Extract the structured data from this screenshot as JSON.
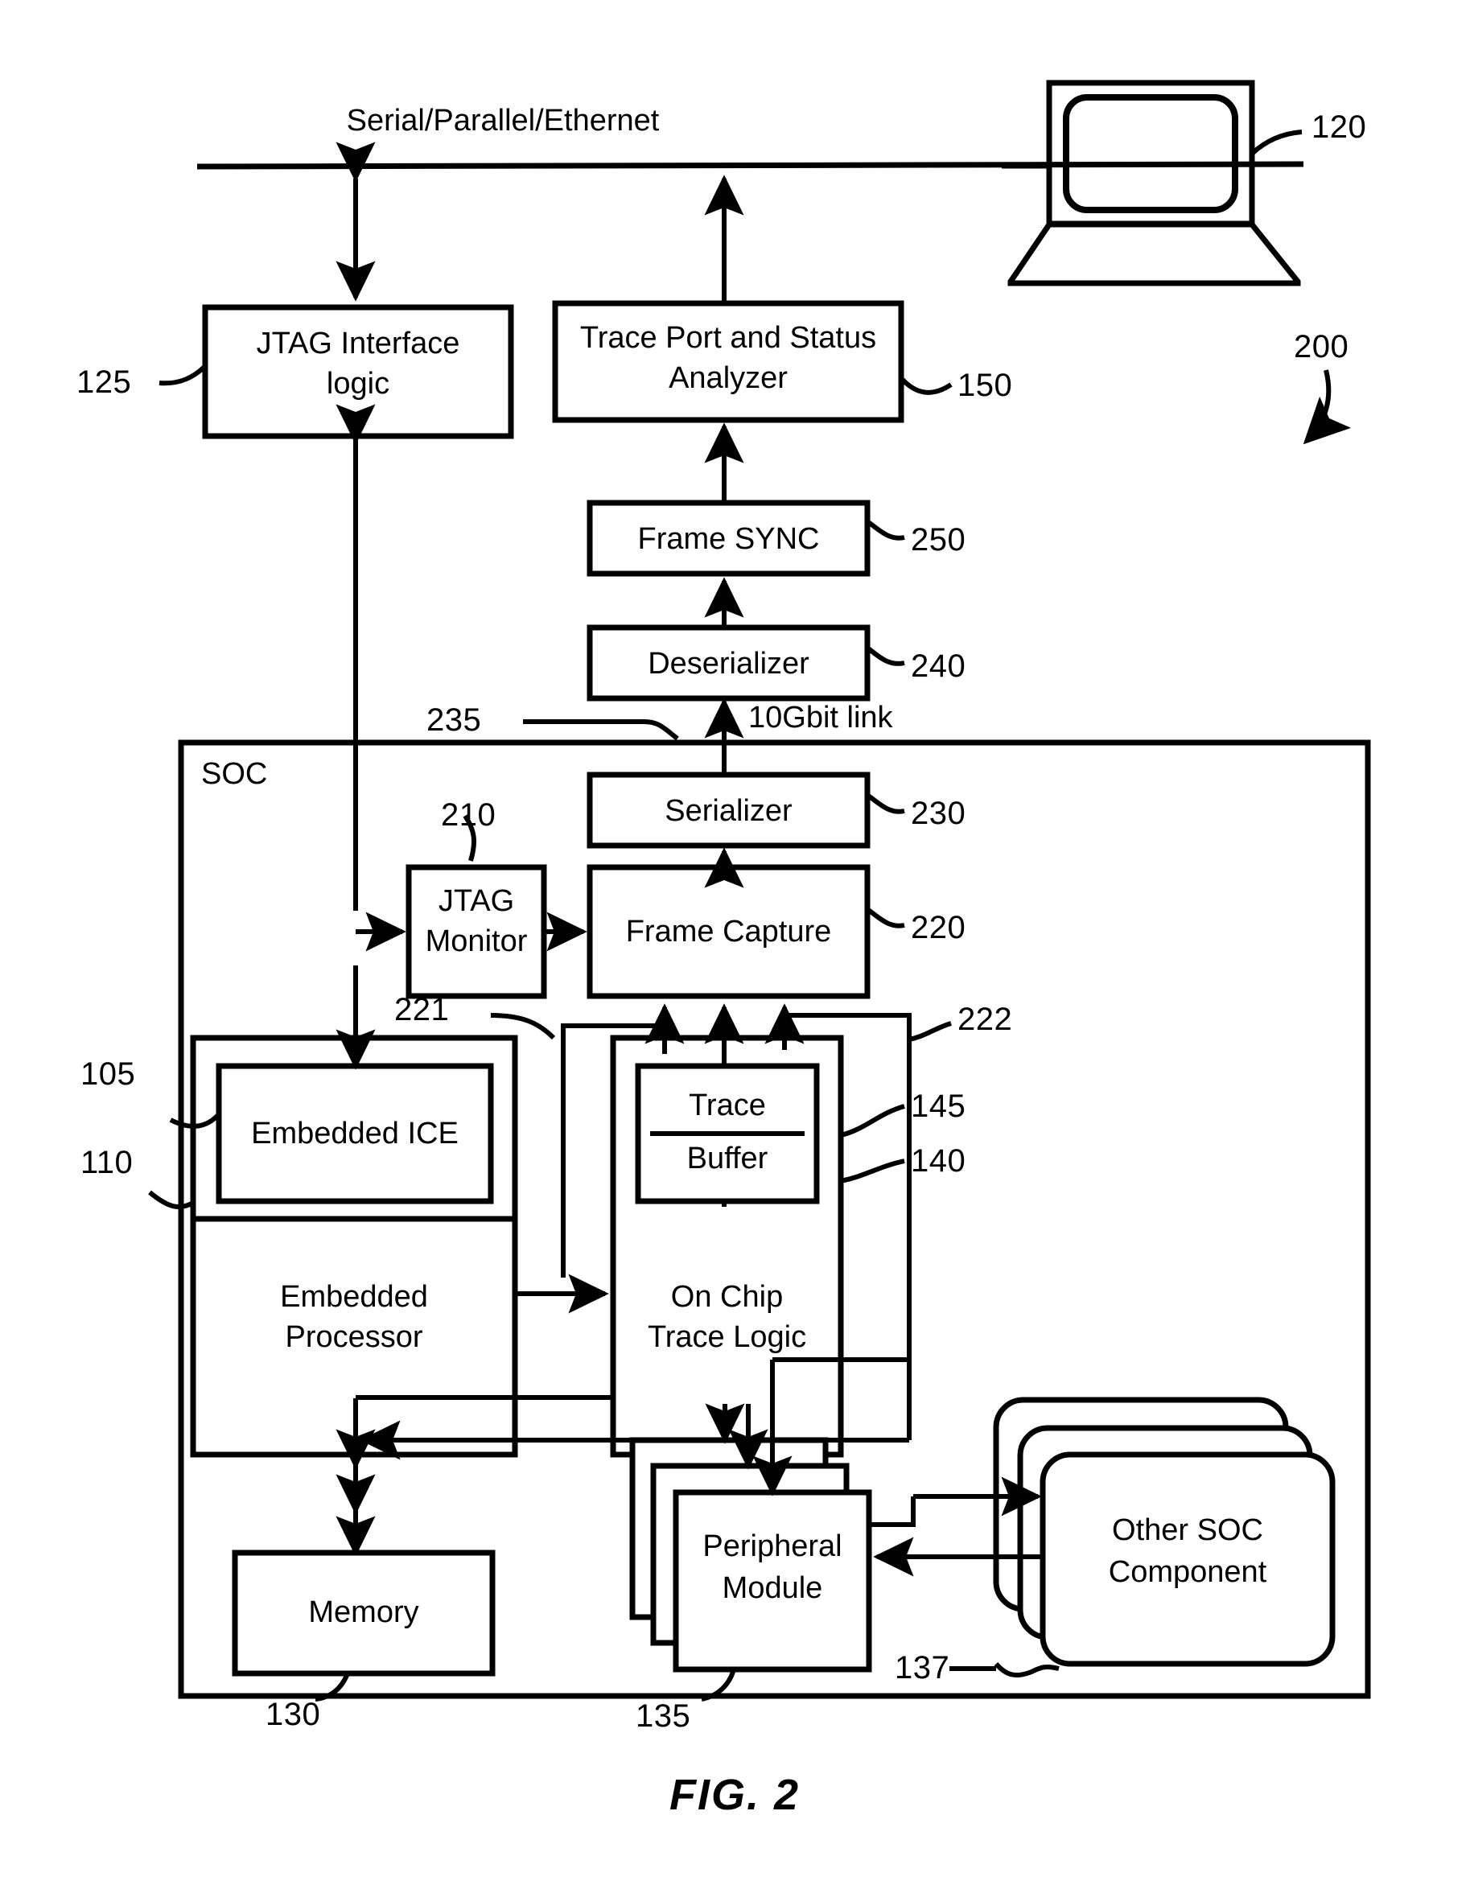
{
  "figure": {
    "caption": "FIG. 2",
    "system_ref": "200"
  },
  "bus": {
    "label": "Serial/Parallel/Ethernet"
  },
  "host": {
    "name": "laptop-computer",
    "ref": "120"
  },
  "blocks": [
    {
      "id": "jtag-interface-logic",
      "lines": [
        "JTAG Interface",
        "logic"
      ],
      "ref": "125"
    },
    {
      "id": "trace-port-status-analyzer",
      "lines": [
        "Trace Port and Status",
        "Analyzer"
      ],
      "ref": "150"
    },
    {
      "id": "frame-sync",
      "lines": [
        "Frame SYNC"
      ],
      "ref": "250"
    },
    {
      "id": "deserializer",
      "lines": [
        "Deserializer"
      ],
      "ref": "240"
    },
    {
      "id": "serializer",
      "lines": [
        "Serializer"
      ],
      "ref": "230"
    },
    {
      "id": "jtag-monitor",
      "lines": [
        "JTAG",
        "Monitor"
      ],
      "ref": "210"
    },
    {
      "id": "frame-capture",
      "lines": [
        "Frame Capture"
      ],
      "ref": "220"
    },
    {
      "id": "embedded-ice",
      "lines": [
        "Embedded ICE"
      ],
      "ref": "105"
    },
    {
      "id": "embedded-processor",
      "lines": [
        "Embedded",
        "Processor"
      ],
      "ref": "110"
    },
    {
      "id": "trace-buffer",
      "lines": [
        "Trace",
        "Buffer"
      ],
      "ref": "145"
    },
    {
      "id": "on-chip-trace-logic",
      "lines": [
        "On Chip",
        "Trace Logic"
      ],
      "ref": "140"
    },
    {
      "id": "memory",
      "lines": [
        "Memory"
      ],
      "ref": "130"
    },
    {
      "id": "peripheral-module",
      "lines": [
        "Peripheral",
        "Module"
      ],
      "ref": "135"
    },
    {
      "id": "other-soc-component",
      "lines": [
        "Other SOC",
        "Component"
      ],
      "ref": "137"
    }
  ],
  "soc": {
    "tag": "SOC"
  },
  "links": {
    "tengbit_label": "10Gbit link",
    "tengbit_ref": "235",
    "frame_capture_input_left_ref": "221",
    "frame_capture_input_right_ref": "222"
  },
  "text": {
    "bus_label": "Serial/Parallel/Ethernet",
    "jtag_interface_line1": "JTAG Interface",
    "jtag_interface_line2": "logic",
    "trace_port_line1": "Trace Port and Status",
    "trace_port_line2": "Analyzer",
    "frame_sync": "Frame SYNC",
    "deserializer": "Deserializer",
    "serializer": "Serializer",
    "jtag_monitor_line1": "JTAG",
    "jtag_monitor_line2": "Monitor",
    "frame_capture": "Frame Capture",
    "embedded_ice": "Embedded ICE",
    "embedded_processor_line1": "Embedded",
    "embedded_processor_line2": "Processor",
    "trace": "Trace",
    "buffer": "Buffer",
    "on_chip_line1": "On Chip",
    "on_chip_line2": "Trace Logic",
    "memory": "Memory",
    "peripheral_line1": "Peripheral",
    "peripheral_line2": "Module",
    "other_soc_line1": "Other SOC",
    "other_soc_line2": "Component",
    "soc": "SOC",
    "tengbit": "10Gbit link",
    "fig_caption": "FIG. 2"
  },
  "refs": {
    "r120": "120",
    "r125": "125",
    "r150": "150",
    "r200": "200",
    "r250": "250",
    "r240": "240",
    "r235": "235",
    "r230": "230",
    "r210": "210",
    "r220": "220",
    "r221": "221",
    "r222": "222",
    "r105": "105",
    "r110": "110",
    "r145": "145",
    "r140": "140",
    "r130": "130",
    "r135": "135",
    "r137": "137"
  },
  "colors": {
    "ink": "#000000",
    "paper": "#ffffff"
  }
}
